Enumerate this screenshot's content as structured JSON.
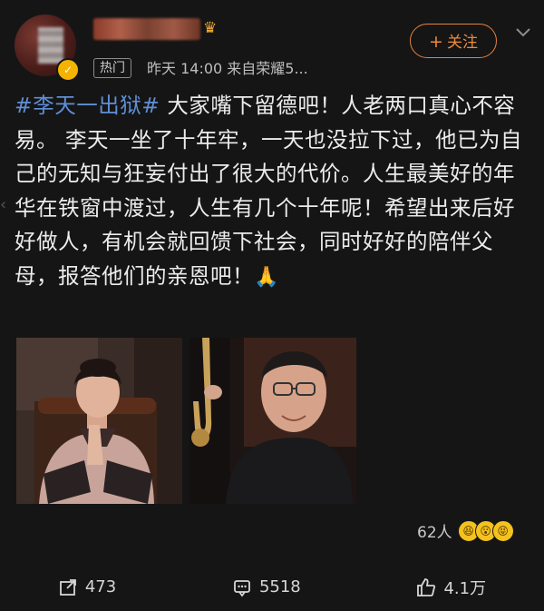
{
  "header": {
    "badge": "热门",
    "meta": "昨天 14:00   来自荣耀5...",
    "follow_label": "关注"
  },
  "post": {
    "hashtag": "#李天一出狱#",
    "body": " 大家嘴下留德吧！人老两口真心不容易。 李天一坐了十年牢，一天也没拉下过，他已为自己的无知与狂妄付出了很大的代价。人生最美好的年华在铁窗中渡过，人生有几个十年呢！希望出来后好好做人，有机会就回馈下社会，同时好好的陪伴父母，报答他们的亲恩吧！"
  },
  "reactions": {
    "count_label": "62人"
  },
  "actions": {
    "share": "473",
    "comment": "5518",
    "like": "4.1万"
  },
  "colors": {
    "accent": "#ec8a3e",
    "hashtag": "#5f8fd6",
    "background": "#151515"
  }
}
